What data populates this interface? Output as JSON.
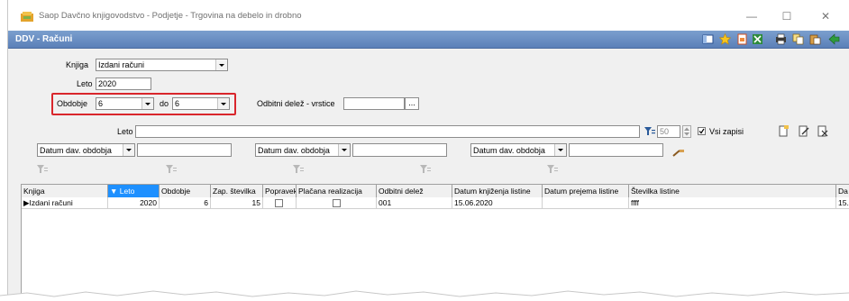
{
  "window": {
    "title": "Saop Davčno knjigovodstvo - Podjetje - Trgovina na debelo in drobno",
    "minimize": "—",
    "maximize": "☐",
    "close": "✕"
  },
  "header": {
    "title": "DDV - Računi"
  },
  "toolbar": {
    "icons": [
      "columns-icon",
      "star-icon",
      "new-document-icon",
      "excel-icon",
      "print-icon",
      "copy-icon",
      "paste-icon",
      "exit-icon"
    ]
  },
  "form": {
    "knjiga_label": "Knjiga",
    "knjiga_value": "Izdani računi",
    "leto_label": "Leto",
    "leto_value": "2020",
    "obdobje_label": "Obdobje",
    "obdobje_value": "6",
    "do_label": "do",
    "do_value": "6",
    "odbitni_label": "Odbitni delež - vrstice",
    "odbitni_value": "",
    "dots": "..."
  },
  "filter": {
    "leto_label": "Leto",
    "leto_value": "",
    "limit_value": "50",
    "vsi_zapisi_label": "Vsi zapisi",
    "vsi_zapisi_checked": true,
    "dd1": "Datum dav. obdobja",
    "dd2": "Datum dav. obdobja",
    "dd3": "Datum dav. obdobja"
  },
  "grid": {
    "columns": [
      "Knjiga",
      "Leto",
      "Obdobje",
      "Zap. številka",
      "Popravek",
      "Plačana realizacija",
      "Odbitni delež",
      "Datum knjiženja listine",
      "Datum prejema listine",
      "Številka listine",
      "Da"
    ],
    "rows": [
      {
        "knjiga": "Izdani računi",
        "leto": "2020",
        "obdobje": "6",
        "zap": "15",
        "popravek": false,
        "placana": false,
        "odbitni": "001",
        "datum_knjizenja": "15.06.2020",
        "datum_prejema": "",
        "stevilka": "ffff",
        "da": "15."
      }
    ]
  },
  "colors": {
    "header_bar": "#5b80b8",
    "sort_column": "#1e90ff",
    "highlight": "#d9262c"
  }
}
